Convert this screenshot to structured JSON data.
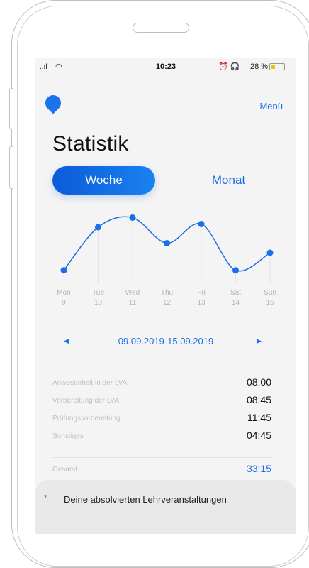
{
  "status_bar": {
    "time": "10:23",
    "battery_percent": "28 %",
    "signal": "..ıl",
    "icons": "⏰ 🎧"
  },
  "header": {
    "menu_label": "Menü",
    "title": "Statistik"
  },
  "segments": {
    "week_label": "Woche",
    "month_label": "Monat",
    "selected": "Woche"
  },
  "chart_data": {
    "type": "line",
    "categories": [
      "Mon",
      "Tue",
      "Wed",
      "Thu",
      "Fri",
      "Sat",
      "Sun"
    ],
    "sub_labels": [
      "9",
      "10",
      "11",
      "12",
      "13",
      "14",
      "15"
    ],
    "values": [
      0.5,
      3.2,
      3.8,
      2.2,
      3.4,
      0.5,
      1.6
    ],
    "ylim": [
      0,
      4
    ],
    "grid": "vertical",
    "smooth": true,
    "color": "#1a6fe6"
  },
  "date_range": "09.09.2019-15.09.2019",
  "breakdown": [
    {
      "label": "Anwesenheit in der LVA",
      "value": "08:00"
    },
    {
      "label": "Vorbereitung der LVA",
      "value": "08:45"
    },
    {
      "label": "Prüfungsvorbereitung",
      "value": "11:45"
    },
    {
      "label": "Sonstiges",
      "value": "04:45"
    }
  ],
  "total": {
    "label": "Gesamt",
    "value": "33:15"
  },
  "bottom_sheet": {
    "label": "Deine absolvierten Lehrveranstaltungen"
  },
  "colors": {
    "accent": "#1a6fe6",
    "background": "#f4f4f4"
  }
}
